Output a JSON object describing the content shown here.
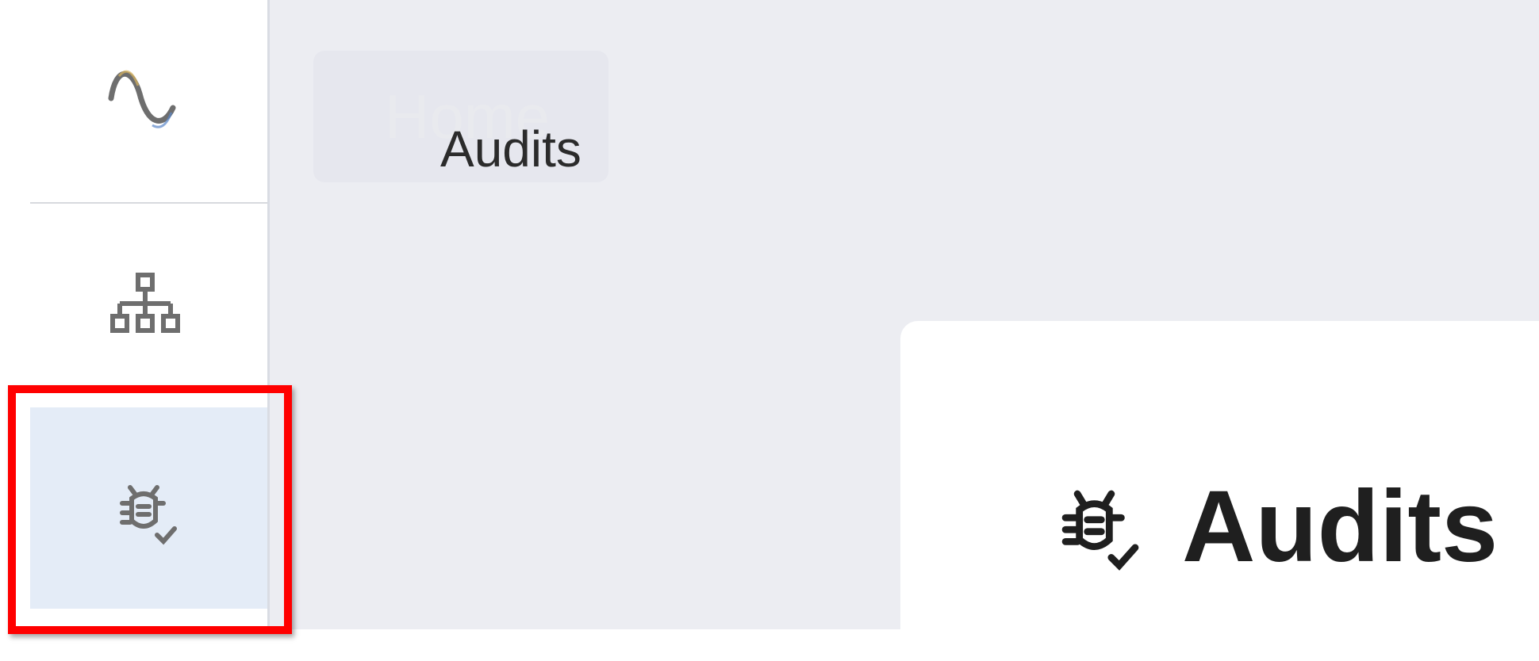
{
  "sidebar": {
    "logo_icon": "sine-wave-icon",
    "items": [
      {
        "icon": "hierarchy-icon",
        "name": "hierarchy"
      },
      {
        "icon": "bug-check-icon",
        "name": "audits",
        "active": true
      }
    ]
  },
  "breadcrumb": {
    "home": "Home",
    "current": "Audits"
  },
  "page": {
    "title": "Audits",
    "title_icon": "bug-check-icon"
  },
  "colors": {
    "active_nav_bg": "#e4ecf7",
    "highlight": "#ff0000",
    "main_bg": "#ecedf2",
    "icon_gray": "#6e6e6e"
  }
}
